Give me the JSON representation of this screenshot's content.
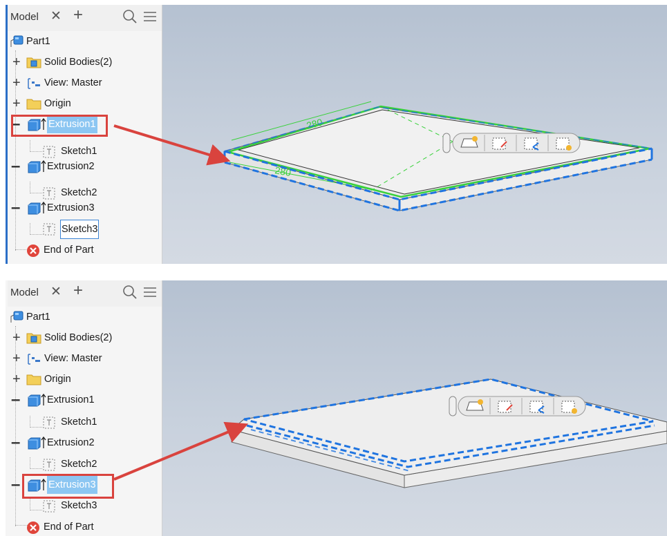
{
  "panels": [
    {
      "browser": {
        "tab_label": "Model",
        "tree": {
          "part": "Part1",
          "solid_bodies": "Solid Bodies(2)",
          "view": "View: Master",
          "origin": "Origin",
          "extrusion1": "Extrusion1",
          "sketch1": "Sketch1",
          "extrusion2": "Extrusion2",
          "sketch2": "Sketch2",
          "extrusion3": "Extrusion3",
          "sketch3": "Sketch3",
          "end_of_part": "End of Part"
        },
        "selected_item": "Extrusion1"
      },
      "viewport": {
        "dimension_front": "280",
        "dimension_back": "280"
      }
    },
    {
      "browser": {
        "tab_label": "Model",
        "tree": {
          "part": "Part1",
          "solid_bodies": "Solid Bodies(2)",
          "view": "View: Master",
          "origin": "Origin",
          "extrusion1": "Extrusion1",
          "sketch1": "Sketch1",
          "extrusion2": "Extrusion2",
          "sketch2": "Sketch2",
          "extrusion3": "Extrusion3",
          "sketch3": "Sketch3",
          "end_of_part": "End of Part"
        },
        "selected_item": "Extrusion3"
      }
    }
  ],
  "colors": {
    "selection_blue": "#1f74e0",
    "sketch_green": "#38d13a",
    "annotation_red": "#d9433e",
    "tree_selected": "#8cc6f2"
  },
  "icons": [
    "part-icon",
    "folder-icon",
    "view-icon",
    "extrusion-icon",
    "sketch-icon",
    "error-icon",
    "search-icon",
    "menu-icon",
    "close-icon",
    "plus-icon",
    "minus-icon"
  ]
}
